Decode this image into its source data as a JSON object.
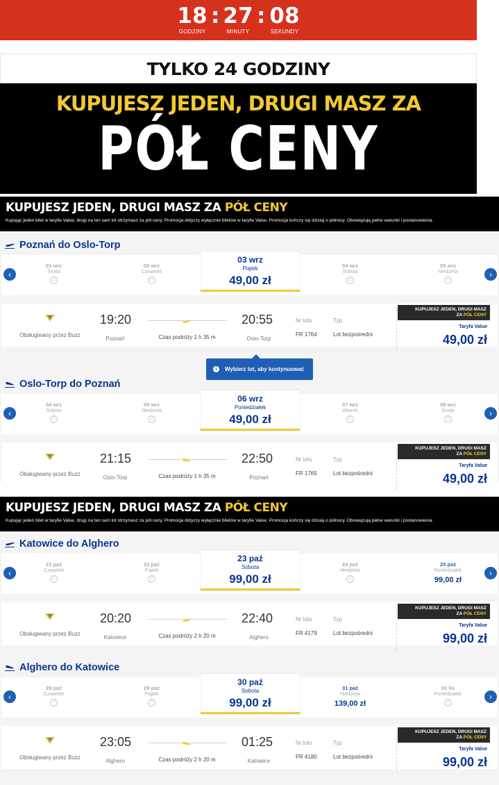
{
  "countdown": {
    "hours": "18",
    "minutes": "27",
    "seconds": "08",
    "hours_label": "GODZINY",
    "minutes_label": "MINUTY",
    "seconds_label": "SEKUNDY"
  },
  "promo": {
    "line1": "TYLKO 24 GODZINY",
    "line2": "KUPUJESZ JEDEN, DRUGI MASZ ZA",
    "line3": "PÓŁ CENY"
  },
  "banner": {
    "title": "KUPUJESZ JEDEN, DRUGI MASZ ZA",
    "title_highlight": "PÓŁ CENY",
    "subtitle": "Kupując jeden bilet w taryfie Value, drugi na ten sam lot otrzymasz za pół ceny. Promocja dotyczy wyłącznie biletów w taryfie Value.  Promocja kończy się dzisiaj o północy. Obowiązują pełne warunki i postanowienia."
  },
  "tooltip": "Wybierz lot, aby kontynuować",
  "sections": [
    {
      "route": "Poznań do Oslo-Torp",
      "dates": [
        {
          "d": "01 wrz",
          "w": "Środa"
        },
        {
          "d": "02 wrz",
          "w": "Czwartek"
        },
        {
          "d": "03 wrz",
          "w": "Piątek",
          "p": "49,00 zł"
        },
        {
          "d": "04 wrz",
          "w": "Sobota"
        },
        {
          "d": "05 wrz",
          "w": "Niedziela"
        }
      ],
      "flight": {
        "operator": "Obsługiwany przez Buzz",
        "dep": "19:20",
        "dep_ap": "Poznań",
        "arr": "20:55",
        "arr_ap": "Oslo-Torp",
        "dur": "Czas podróży 1 h 35 m",
        "nr_label": "Nr lotu",
        "nr": "FR 1764",
        "typ_label": "Typ",
        "typ": "Lot bezpośredni",
        "badge1": "KUPUJESZ JEDEN, DRUGI MASZ",
        "badge2a": "ZA",
        "badge2b": "PÓŁ CENY",
        "fare": "Taryfa Value",
        "price": "49,00 zł"
      }
    },
    {
      "route": "Oslo-Torp do Poznań",
      "dates": [
        {
          "d": "04 wrz",
          "w": "Sobota"
        },
        {
          "d": "05 wrz",
          "w": "Niedziela"
        },
        {
          "d": "06 wrz",
          "w": "Poniedziałek",
          "p": "49,00 zł"
        },
        {
          "d": "07 wrz",
          "w": "Wtorek"
        },
        {
          "d": "08 wrz",
          "w": "Środa"
        }
      ],
      "flight": {
        "operator": "Obsługiwany przez Buzz",
        "dep": "21:15",
        "dep_ap": "Oslo-Torp",
        "arr": "22:50",
        "arr_ap": "Poznań",
        "dur": "Czas podróży 1 h 35 m",
        "nr_label": "Nr lotu",
        "nr": "FR 1765",
        "typ_label": "Typ",
        "typ": "Lot bezpośredni",
        "badge1": "KUPUJESZ JEDEN, DRUGI MASZ",
        "badge2a": "ZA",
        "badge2b": "PÓŁ CENY",
        "fare": "Taryfa Value",
        "price": "49,00 zł"
      }
    },
    {
      "route": "Katowice do Alghero",
      "dates": [
        {
          "d": "21 paź",
          "w": "Czwartek"
        },
        {
          "d": "22 paź",
          "w": "Piątek"
        },
        {
          "d": "23 paź",
          "w": "Sobota",
          "p": "99,00 zł"
        },
        {
          "d": "24 paź",
          "w": "Niedziela"
        },
        {
          "d": "25 paź",
          "w": "Poniedziałek",
          "p": "99,00 zł"
        }
      ],
      "flight": {
        "operator": "Obsługiwany przez Buzz",
        "dep": "20:20",
        "dep_ap": "Katowice",
        "arr": "22:40",
        "arr_ap": "Alghero",
        "dur": "Czas podróży 2 h 20 m",
        "nr_label": "Nr lotu",
        "nr": "FR 4179",
        "typ_label": "Typ",
        "typ": "Lot bezpośredni",
        "badge1": "KUPUJESZ JEDEN, DRUGI MASZ",
        "badge2a": "ZA",
        "badge2b": "PÓŁ CENY",
        "fare": "Taryfa Value",
        "price": "99,00 zł"
      }
    },
    {
      "route": "Alghero do Katowice",
      "dates": [
        {
          "d": "28 paź",
          "w": "Czwartek"
        },
        {
          "d": "29 paź",
          "w": "Piątek"
        },
        {
          "d": "30 paź",
          "w": "Sobota",
          "p": "99,00 zł"
        },
        {
          "d": "31 paź",
          "w": "Niedziela",
          "p": "139,00 zł"
        },
        {
          "d": "01 lis",
          "w": "Poniedziałek"
        }
      ],
      "flight": {
        "operator": "Obsługiwany przez Buzz",
        "dep": "23:05",
        "dep_ap": "Alghero",
        "arr": "01:25",
        "arr_ap": "Katowice",
        "dur": "Czas podróży 2 h 20 m",
        "nr_label": "Nr lotu",
        "nr": "FR 4180",
        "typ_label": "Typ",
        "typ": "Lot bezpośredni",
        "badge1": "KUPUJESZ JEDEN, DRUGI MASZ",
        "badge2a": "ZA",
        "badge2b": "PÓŁ CENY",
        "fare": "Taryfa Value",
        "price": "99,00 zł"
      }
    }
  ],
  "colors": {
    "red": "#d6311d",
    "navy": "#073590",
    "yellow": "#f1c933",
    "blue": "#1f5fb3"
  }
}
